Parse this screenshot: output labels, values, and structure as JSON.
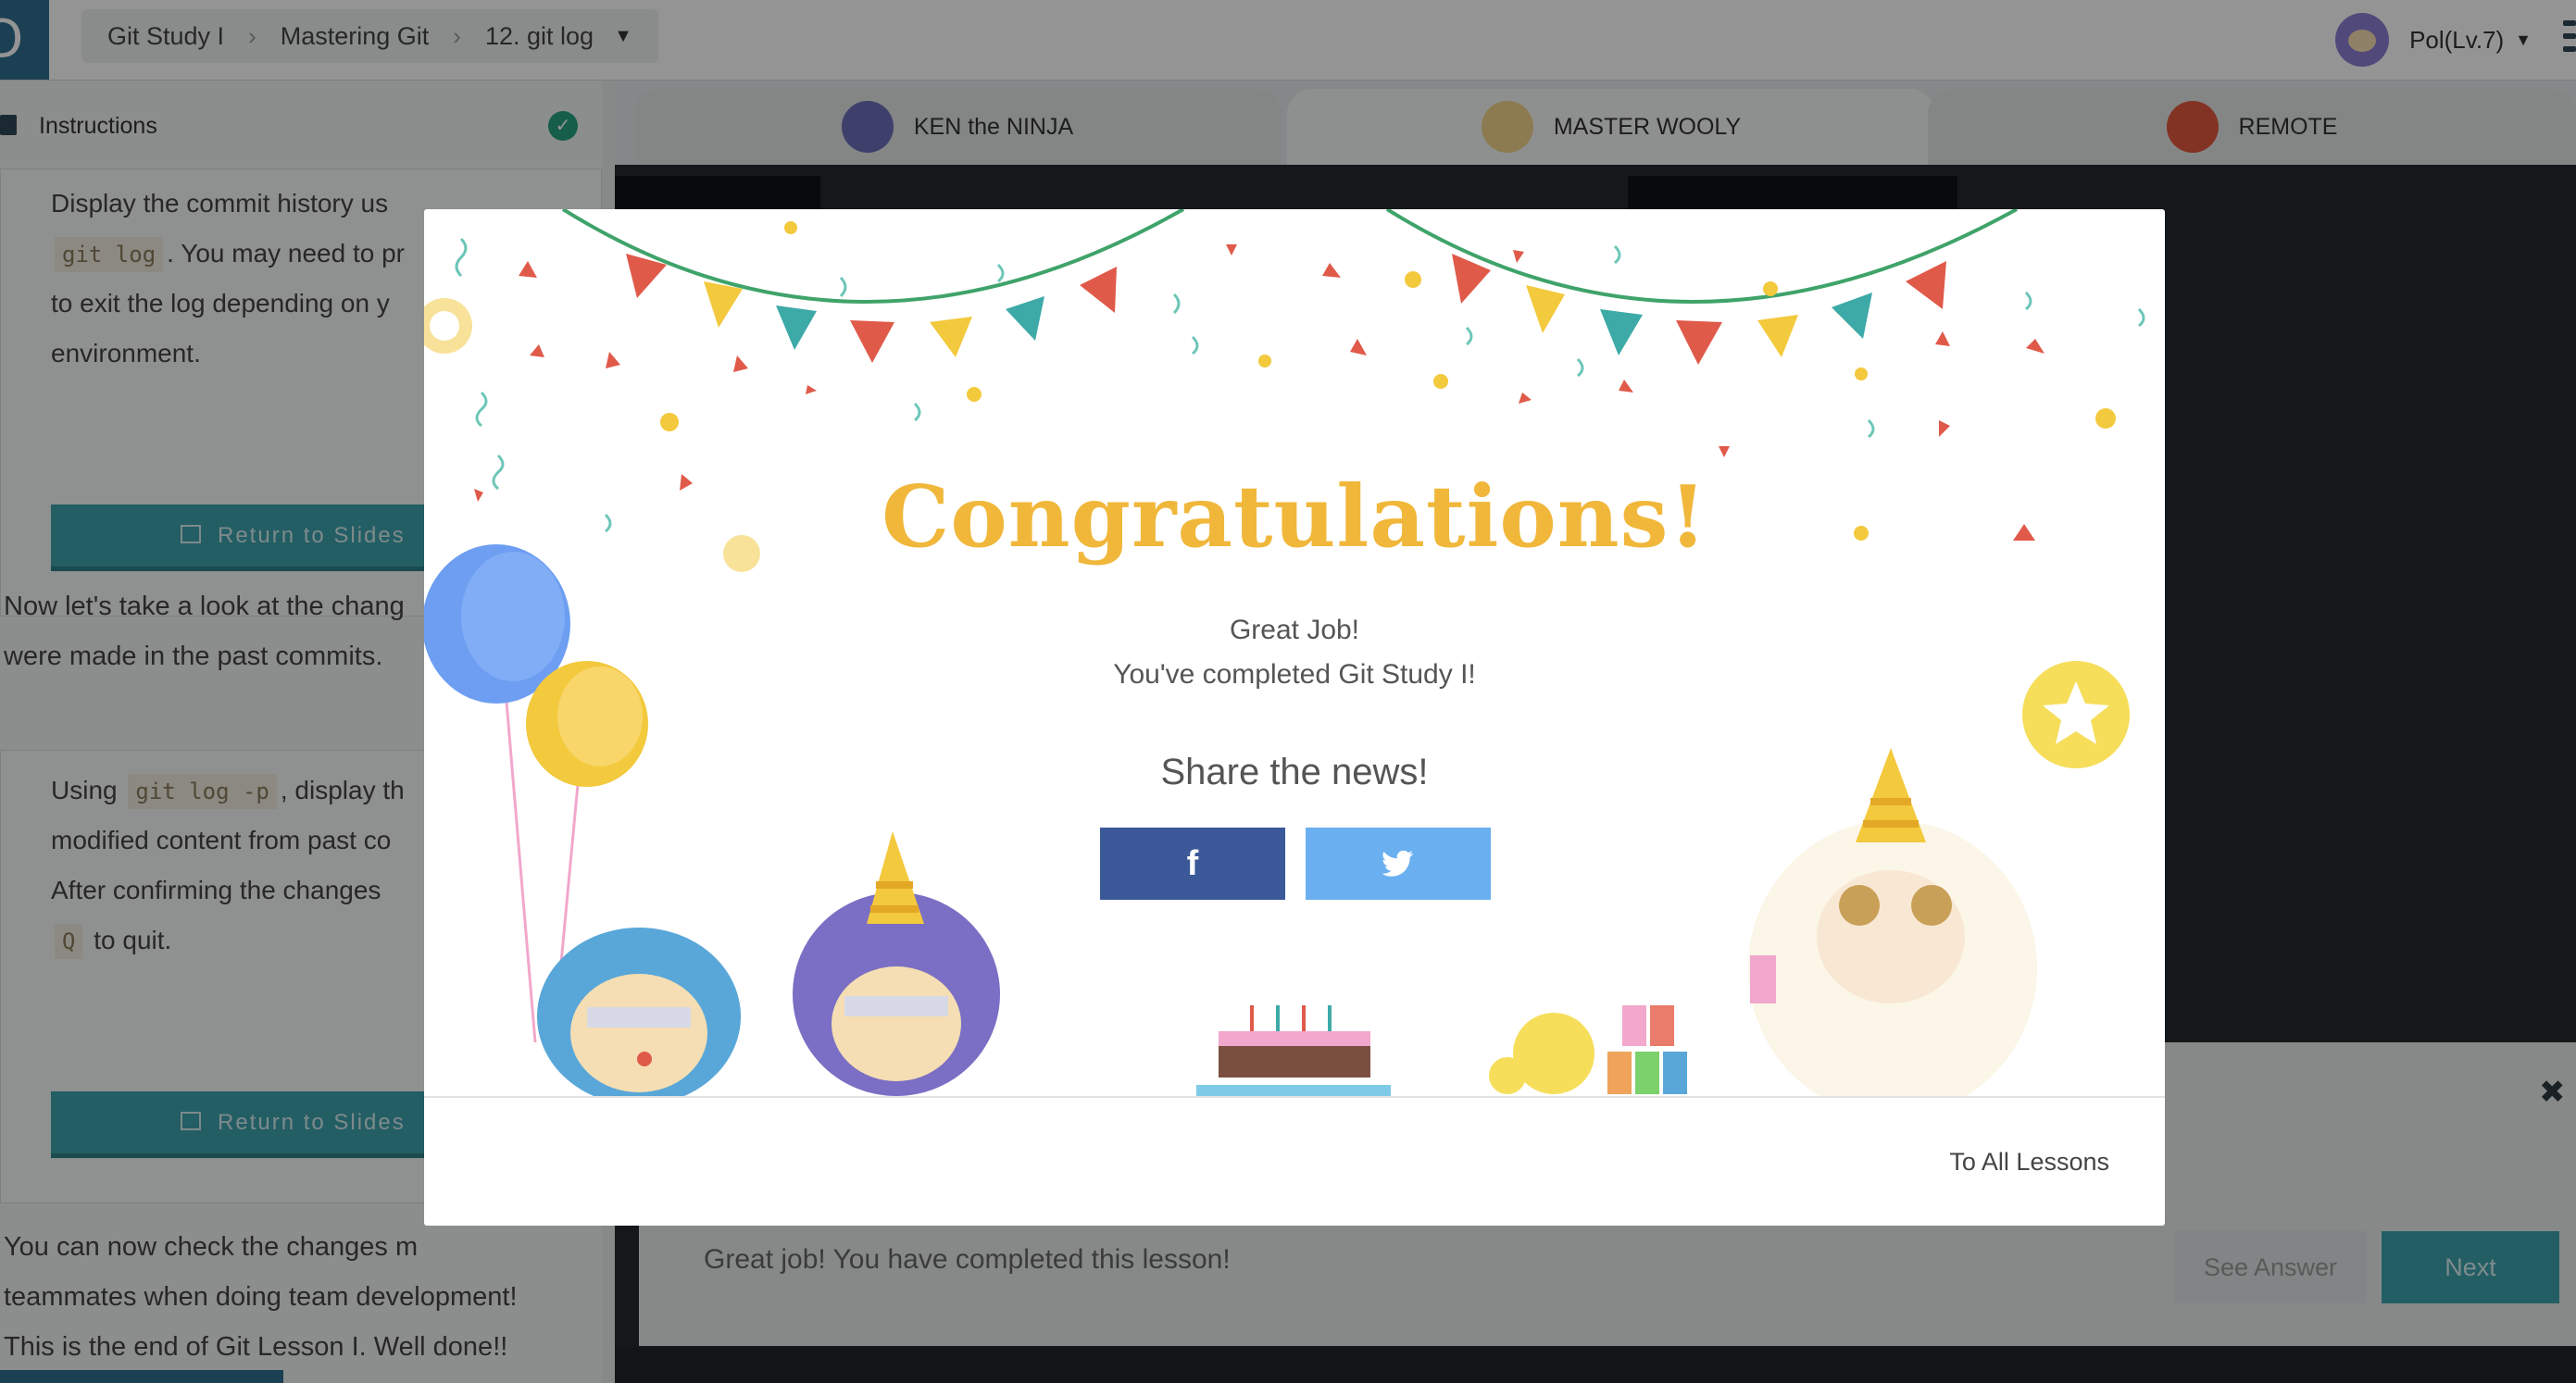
{
  "header": {
    "logo_glyph": "Ↄ",
    "breadcrumb": [
      "Git Study I",
      "Mastering Git",
      "12. git log"
    ],
    "breadcrumb_sep": "›",
    "breadcrumb_caret": "▼",
    "user_label": "Pol(Lv.7)",
    "user_caret": "▼"
  },
  "instructions": {
    "title": "Instructions",
    "check_glyph": "✓",
    "card1": {
      "line1": "Display the commit history us",
      "line2_code": "git log",
      "line2_text": ". You may need to pr",
      "line3": "to exit the log depending on y",
      "line4": "environment.",
      "button": "Return to Slides"
    },
    "para1": [
      "Now let's take a look at the chang",
      "were made in the past commits."
    ],
    "card2": {
      "line1_pre": "Using",
      "line1_code": "git log -p",
      "line1_post": ", display th",
      "line2": "modified content from past co",
      "line3": "After confirming the changes",
      "line4_code": "Q",
      "line4_text": "to quit.",
      "button": "Return to Slides"
    },
    "para2": [
      "You can now check the changes m",
      "teammates when doing team development!",
      "This is the end of Git Lesson I. Well done!!"
    ]
  },
  "tabs": [
    {
      "label": "KEN the NINJA",
      "icon": "ninja-avatar-icon",
      "color": "#6b6fb8"
    },
    {
      "label": "MASTER WOOLY",
      "icon": "sheep-avatar-icon",
      "color": "#f1d48a"
    },
    {
      "label": "REMOTE",
      "icon": "git-remote-icon",
      "color": "#e2583e"
    }
  ],
  "bottom": {
    "message": "Great job! You have completed this lesson!",
    "see_answer": "See Answer",
    "next": "Next",
    "close_glyph": "✖"
  },
  "modal": {
    "title": "Congratulations!",
    "line1": "Great Job!",
    "line2": "You've completed Git Study I!",
    "share": "Share the news!",
    "facebook_glyph": "f",
    "to_all_lessons": "To All Lessons"
  },
  "colors": {
    "accent": "#3da3ad",
    "title_gold": "#f0b73a",
    "facebook": "#3b5998",
    "twitter": "#6aaff0",
    "success": "#26a37e"
  }
}
